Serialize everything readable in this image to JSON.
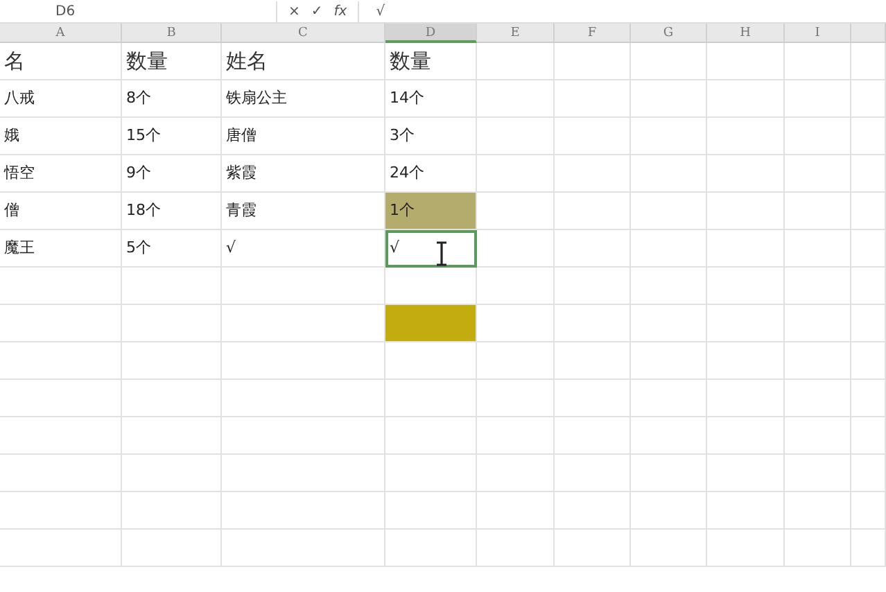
{
  "formula_bar": {
    "name_box": "D6",
    "cancel": "×",
    "confirm": "✓",
    "fx": "fx",
    "content": "√"
  },
  "columns": [
    {
      "label": "A",
      "selected": false
    },
    {
      "label": "B",
      "selected": false
    },
    {
      "label": "C",
      "selected": false
    },
    {
      "label": "D",
      "selected": true
    },
    {
      "label": "E",
      "selected": false
    },
    {
      "label": "F",
      "selected": false
    },
    {
      "label": "G",
      "selected": false
    },
    {
      "label": "H",
      "selected": false
    },
    {
      "label": "I",
      "selected": false
    }
  ],
  "rows": [
    [
      {
        "text": "名",
        "kind": "header",
        "selected": false
      },
      {
        "text": "数量",
        "kind": "header",
        "selected": false
      },
      {
        "text": "姓名",
        "kind": "header",
        "selected": false
      },
      {
        "text": "数量",
        "kind": "header",
        "selected": false
      }
    ],
    [
      {
        "text": "八戒",
        "selected": false
      },
      {
        "text": "8个",
        "selected": false
      },
      {
        "text": "铁扇公主",
        "selected": false
      },
      {
        "text": "14个",
        "selected": false
      }
    ],
    [
      {
        "text": "娥",
        "selected": false
      },
      {
        "text": "15个",
        "selected": false
      },
      {
        "text": "唐僧",
        "selected": false
      },
      {
        "text": "3个",
        "selected": false
      }
    ],
    [
      {
        "text": "悟空",
        "selected": false
      },
      {
        "text": "9个",
        "selected": false
      },
      {
        "text": "紫霞",
        "selected": false
      },
      {
        "text": "24个",
        "selected": false
      }
    ],
    [
      {
        "text": "僧",
        "selected": false
      },
      {
        "text": "18个",
        "selected": false
      },
      {
        "text": "青霞",
        "selected": false
      },
      {
        "text": "1个",
        "color": "#b3ac6c",
        "selected": false
      }
    ],
    [
      {
        "text": "魔王",
        "selected": false
      },
      {
        "text": "5个",
        "selected": false
      },
      {
        "text": "√",
        "selected": false
      },
      {
        "text": "√",
        "selected": true
      }
    ],
    [],
    [
      {
        "selected": false
      },
      {
        "selected": false
      },
      {
        "selected": false
      },
      {
        "color": "#c2ac10",
        "selected": false
      }
    ]
  ]
}
